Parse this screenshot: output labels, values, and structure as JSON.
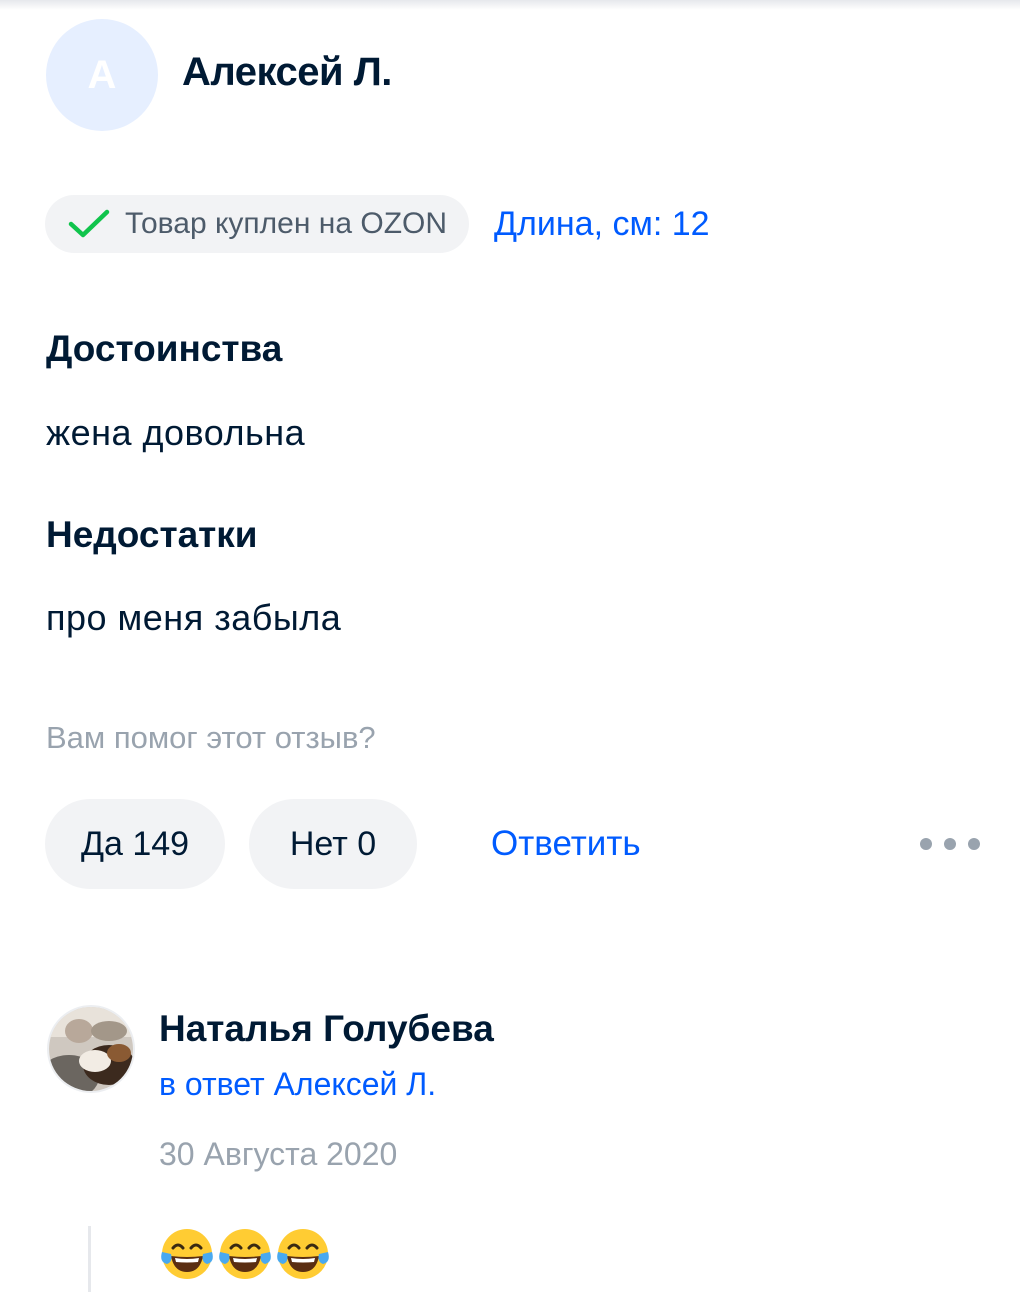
{
  "review": {
    "author_initial": "А",
    "author_name": "Алексей Л.",
    "verified_label": "Товар куплен на OZON",
    "param_label": "Длина, см: 12",
    "pros_title": "Достоинства",
    "pros_text": "жена довольна",
    "cons_title": "Недостатки",
    "cons_text": "про меня забыла",
    "helpful_question": "Вам помог этот отзыв?",
    "yes_label": "Да 149",
    "no_label": "Нет 0",
    "reply_label": "Ответить",
    "more_icon": "more-dots-icon"
  },
  "comment": {
    "author_name": "Наталья Голубева",
    "reply_to": "в ответ Алексей Л.",
    "date": "30 Августа 2020",
    "emojis": [
      "face-with-tears-of-joy-icon",
      "face-with-tears-of-joy-icon",
      "face-with-tears-of-joy-icon"
    ]
  },
  "colors": {
    "accent": "#005bff",
    "text": "#001a34",
    "muted": "#99a3ae",
    "chip_bg": "#f2f3f5",
    "check": "#10c44c"
  }
}
